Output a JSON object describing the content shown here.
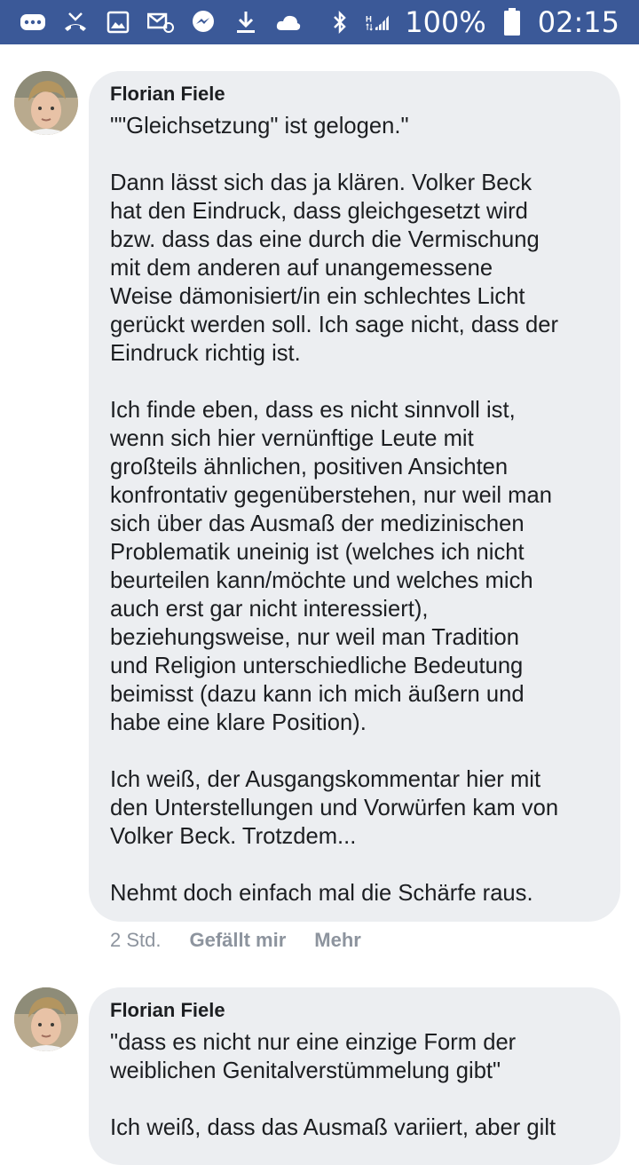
{
  "status_bar": {
    "battery": "100%",
    "time": "02:15"
  },
  "comments": [
    {
      "author": "Florian Fiele",
      "text": "\"\"Gleichsetzung\" ist gelogen.\"\n\nDann lässt sich das ja klären. Volker Beck\nhat den Eindruck, dass gleichgesetzt wird\nbzw. dass das eine durch die Vermischung\nmit dem anderen auf unangemessene\nWeise dämonisiert/in ein schlechtes Licht\ngerückt werden soll. Ich sage nicht, dass der\nEindruck richtig ist.\n\nIch finde eben, dass es nicht sinnvoll ist,\nwenn sich hier vernünftige Leute mit\ngroßteils ähnlichen, positiven Ansichten\nkonfrontativ gegenüberstehen, nur weil man\nsich über das Ausmaß der medizinischen\nProblematik uneinig ist (welches ich nicht\nbeurteilen kann/möchte und welches mich\nauch erst gar nicht interessiert),\nbeziehungsweise, nur weil man Tradition\nund Religion unterschiedliche Bedeutung\nbeimisst (dazu kann ich mich äußern und\nhabe eine klare Position).\n\nIch weiß, der Ausgangskommentar hier mit\nden Unterstellungen und Vorwürfen kam von\nVolker Beck. Trotzdem...\n\nNehmt doch einfach mal die Schärfe raus.",
      "time": "2 Std.",
      "like": "Gefällt mir",
      "more": "Mehr"
    },
    {
      "author": "Florian Fiele",
      "text": "\"dass es nicht nur eine einzige Form der\nweiblichen Genitalverstümmelung gibt\"\n\nIch weiß, dass das Ausmaß variiert, aber gilt"
    }
  ]
}
